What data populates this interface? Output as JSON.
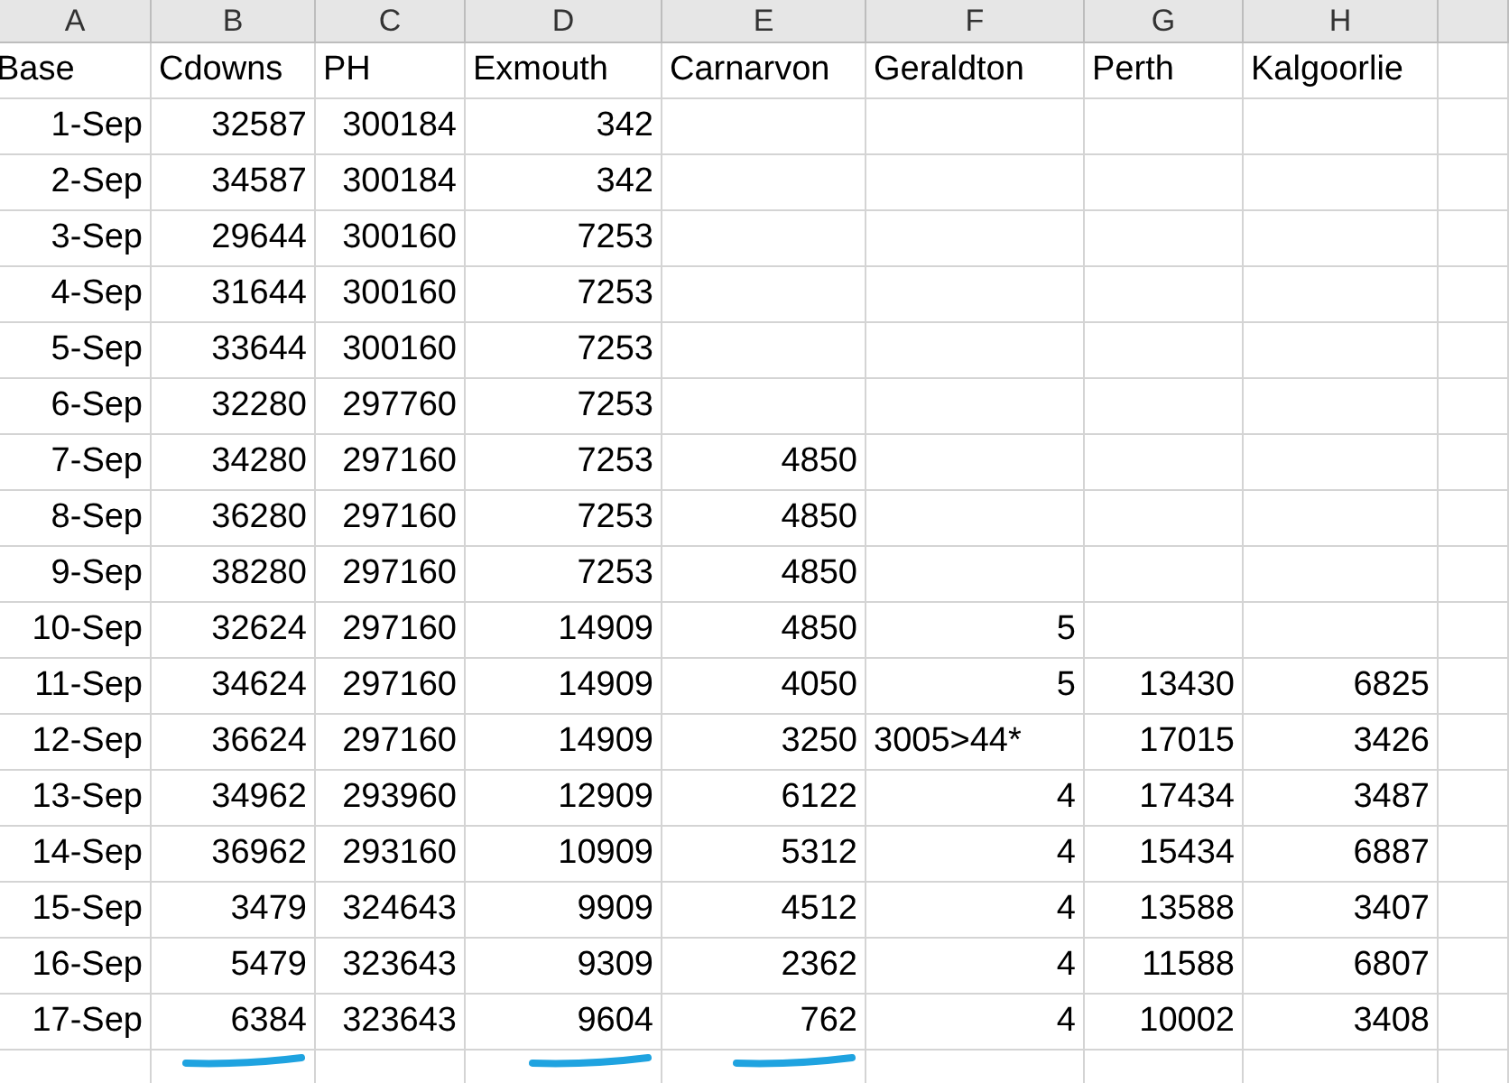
{
  "columns": [
    {
      "letter": "A",
      "marked": false
    },
    {
      "letter": "B",
      "marked": true
    },
    {
      "letter": "C",
      "marked": false
    },
    {
      "letter": "D",
      "marked": true
    },
    {
      "letter": "E",
      "marked": true
    },
    {
      "letter": "F",
      "marked": false
    },
    {
      "letter": "G",
      "marked": false
    },
    {
      "letter": "H",
      "marked": false
    }
  ],
  "header_row": [
    "Base",
    "Cdowns",
    "PH",
    "Exmouth",
    "Carnarvon",
    "Geraldton",
    "Perth",
    "Kalgoorlie"
  ],
  "rows": [
    [
      "1-Sep",
      "32587",
      "300184",
      "342"
    ],
    [
      "2-Sep",
      "34587",
      "300184",
      "342"
    ],
    [
      "3-Sep",
      "29644",
      "300160",
      "7253"
    ],
    [
      "4-Sep",
      "31644",
      "300160",
      "7253"
    ],
    [
      "5-Sep",
      "33644",
      "300160",
      "7253"
    ],
    [
      "6-Sep",
      "32280",
      "297760",
      "7253"
    ],
    [
      "7-Sep",
      "34280",
      "297160",
      "7253",
      "4850"
    ],
    [
      "8-Sep",
      "36280",
      "297160",
      "7253",
      "4850"
    ],
    [
      "9-Sep",
      "38280",
      "297160",
      "7253",
      "4850"
    ],
    [
      "10-Sep",
      "32624",
      "297160",
      "14909",
      "4850",
      "5"
    ],
    [
      "11-Sep",
      "34624",
      "297160",
      "14909",
      "4050",
      "5",
      "13430",
      "6825"
    ],
    [
      "12-Sep",
      "36624",
      "297160",
      "14909",
      "3250",
      {
        "text": "3005>44*",
        "kind": "text"
      },
      "17015",
      "3426"
    ],
    [
      "13-Sep",
      "34962",
      "293960",
      "12909",
      "6122",
      "4",
      "17434",
      "3487"
    ],
    [
      "14-Sep",
      "36962",
      "293160",
      "10909",
      "5312",
      "4",
      "15434",
      "6887"
    ],
    [
      "15-Sep",
      "3479",
      "324643",
      "9909",
      "4512",
      "4",
      "13588",
      "3407"
    ],
    [
      "16-Sep",
      "5479",
      "323643",
      "9309",
      "2362",
      "4",
      "11588",
      "6807"
    ],
    [
      "17-Sep",
      "6384",
      "323643",
      "9604",
      "762",
      "4",
      "10002",
      "3408"
    ]
  ]
}
